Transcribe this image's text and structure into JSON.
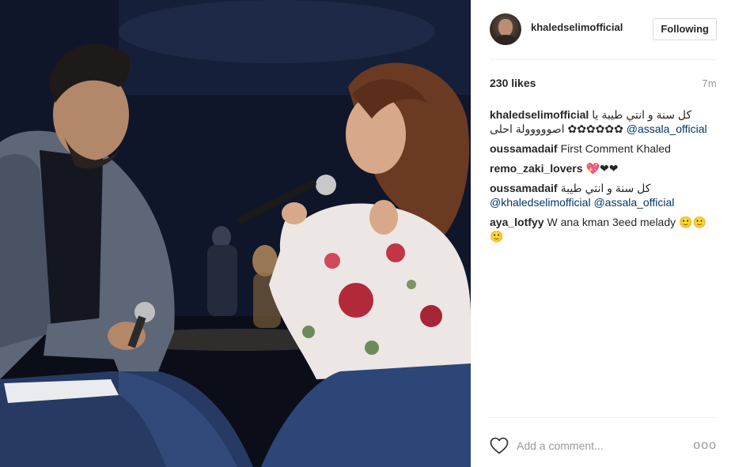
{
  "post": {
    "username": "khaledselimofficial",
    "follow_label": "Following",
    "likes": "230 likes",
    "time": "7m"
  },
  "comments": [
    {
      "user": "khaledselimofficial",
      "text_arabic": "كل سنة و انتي طيبة يا احلى",
      "mention": "@assala_official",
      "tail": "✿✿✿✿✿✿ اصووووولة"
    },
    {
      "user": "oussamadaif",
      "text": "First Comment Khaled"
    },
    {
      "user": "remo_zaki_lovers",
      "text": "💖❤❤"
    },
    {
      "user": "oussamadaif",
      "text_arabic": "كل سنة و انتي طيبة",
      "mention1": "@khaledselimofficial",
      "mention2": "@assala_official"
    },
    {
      "user": "aya_lotfyy",
      "text": "W ana kman 3eed melady 🙂🙂🙂"
    }
  ],
  "add_comment": {
    "placeholder": "Add a comment...",
    "more_label": "ooo"
  },
  "icons": {
    "heart": "heart-outline-icon",
    "more": "more-options-icon"
  },
  "colors": {
    "link": "#003569",
    "muted": "#999999",
    "border": "#dbdbdb"
  }
}
